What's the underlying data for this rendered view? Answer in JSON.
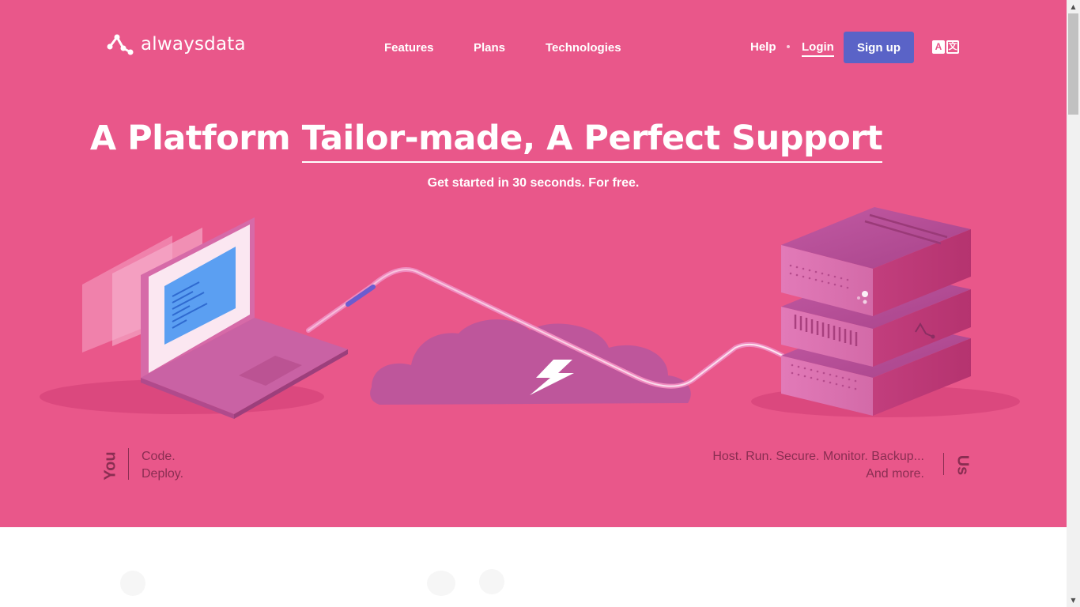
{
  "brand": {
    "name": "alwaysdata"
  },
  "nav": {
    "features": "Features",
    "plans": "Plans",
    "technologies": "Technologies"
  },
  "header": {
    "help": "Help",
    "login": "Login",
    "signup": "Sign up",
    "lang_a": "A",
    "lang_b": "文"
  },
  "hero": {
    "headline_plain_1": "A Platform ",
    "headline_highlight": "Tailor-made, A Perfect Support",
    "subtitle": "Get started in 30 seconds. For free."
  },
  "you": {
    "label": "You",
    "line1": "Code.",
    "line2": "Deploy."
  },
  "us": {
    "label": "Us",
    "line1": "Host. Run. Secure. Monitor. Backup...",
    "line2": "And more."
  },
  "colors": {
    "hero_bg": "#e9578a",
    "signup_bg": "#5a63c7",
    "label_text": "#8a2e52"
  },
  "icons": [
    "alwaysdata-logo-icon",
    "translate-icon",
    "laptop-illustration",
    "cloud-lightning-icon",
    "server-stack-illustration",
    "scroll-up-arrow",
    "scroll-down-arrow"
  ]
}
